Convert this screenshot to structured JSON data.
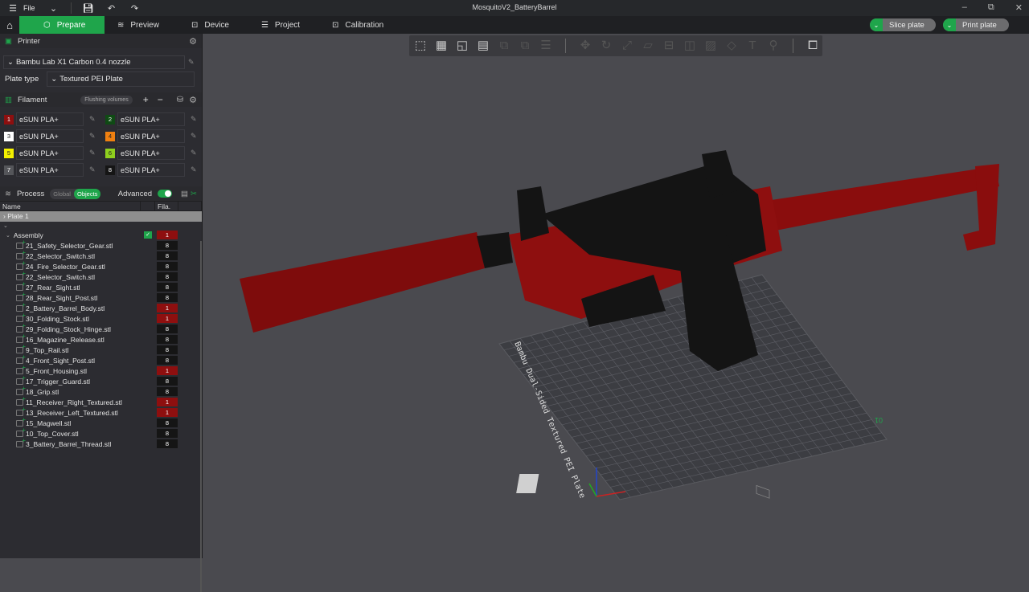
{
  "window": {
    "title": "MosquitoV2_BatteryBarrel",
    "menu_label": "File"
  },
  "tabs": [
    {
      "label": "Prepare",
      "active": true
    },
    {
      "label": "Preview"
    },
    {
      "label": "Device"
    },
    {
      "label": "Project"
    },
    {
      "label": "Calibration"
    }
  ],
  "actions": {
    "slice": "Slice plate",
    "print": "Print plate"
  },
  "printer": {
    "section_label": "Printer",
    "model": "Bambu Lab X1 Carbon 0.4 nozzle",
    "plate_type_label": "Plate type",
    "plate_type": "Textured PEI Plate"
  },
  "filament": {
    "section_label": "Filament",
    "flushing_label": "Flushing volumes",
    "slots": [
      {
        "num": "1",
        "name": "eSUN PLA+",
        "color": "#8e0f0f"
      },
      {
        "num": "2",
        "name": "eSUN PLA+",
        "color": "#0f4a14"
      },
      {
        "num": "3",
        "name": "eSUN PLA+",
        "color": "#ffffff"
      },
      {
        "num": "4",
        "name": "eSUN PLA+",
        "color": "#f08010"
      },
      {
        "num": "5",
        "name": "eSUN PLA+",
        "color": "#f4f000"
      },
      {
        "num": "6",
        "name": "eSUN PLA+",
        "color": "#8fd01e"
      },
      {
        "num": "7",
        "name": "eSUN PLA+",
        "color": "#55565a"
      },
      {
        "num": "8",
        "name": "eSUN PLA+",
        "color": "#151515"
      }
    ]
  },
  "process": {
    "section_label": "Process",
    "global_label": "Global",
    "objects_label": "Objects",
    "advanced_label": "Advanced"
  },
  "tree": {
    "col_name": "Name",
    "col_fila": "Fila.",
    "plate": "Plate 1",
    "assembly": {
      "name": "Assembly",
      "fila": "1"
    },
    "items": [
      {
        "name": "21_Safety_Selector_Gear.stl",
        "fila": "8"
      },
      {
        "name": "22_Selector_Switch.stl",
        "fila": "8"
      },
      {
        "name": "24_Fire_Selector_Gear.stl",
        "fila": "8"
      },
      {
        "name": "22_Selector_Switch.stl",
        "fila": "8"
      },
      {
        "name": "27_Rear_Sight.stl",
        "fila": "8"
      },
      {
        "name": "28_Rear_Sight_Post.stl",
        "fila": "8"
      },
      {
        "name": "2_Battery_Barrel_Body.stl",
        "fila": "1"
      },
      {
        "name": "30_Folding_Stock.stl",
        "fila": "1"
      },
      {
        "name": "29_Folding_Stock_Hinge.stl",
        "fila": "8"
      },
      {
        "name": "16_Magazine_Release.stl",
        "fila": "8"
      },
      {
        "name": "9_Top_Rail.stl",
        "fila": "8"
      },
      {
        "name": "4_Front_Sight_Post.stl",
        "fila": "8"
      },
      {
        "name": "5_Front_Housing.stl",
        "fila": "1"
      },
      {
        "name": "17_Trigger_Guard.stl",
        "fila": "8"
      },
      {
        "name": "18_Grip.stl",
        "fila": "8"
      },
      {
        "name": "11_Receiver_Right_Textured.stl",
        "fila": "1"
      },
      {
        "name": "13_Receiver_Left_Textured.stl",
        "fila": "1"
      },
      {
        "name": "15_Magwell.stl",
        "fila": "8"
      },
      {
        "name": "10_Top_Cover.stl",
        "fila": "8"
      },
      {
        "name": "3_Battery_Barrel_Thread.stl",
        "fila": "8"
      }
    ]
  },
  "viewport": {
    "plate_label": "Bambu Dual-Sided Textured PEI Plate",
    "plate_number": "01",
    "model_colors": {
      "red": "#8e0f0f",
      "black": "#151515"
    }
  }
}
